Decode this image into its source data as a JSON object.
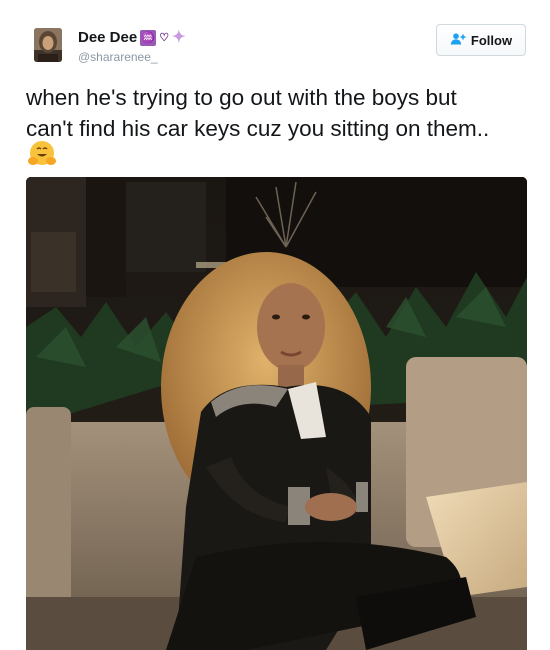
{
  "user": {
    "display_name": "Dee Dee",
    "name_emojis": [
      "aquarius-icon",
      "heart-icon",
      "sparkles-icon"
    ],
    "handle": "@shararenee_"
  },
  "follow_button": {
    "label": "Follow",
    "icon": "add-user-icon",
    "accent_color": "#1da1f2"
  },
  "tweet": {
    "text_lines": [
      "when he's trying to go out with the boys but",
      "can't find his car keys cuz you sitting on them.."
    ],
    "trailing_emoji": "hugging-face-icon"
  },
  "media": {
    "type": "photo"
  },
  "colors": {
    "text": "#14171a",
    "secondary_text": "#8899a6",
    "accent": "#1da1f2"
  }
}
